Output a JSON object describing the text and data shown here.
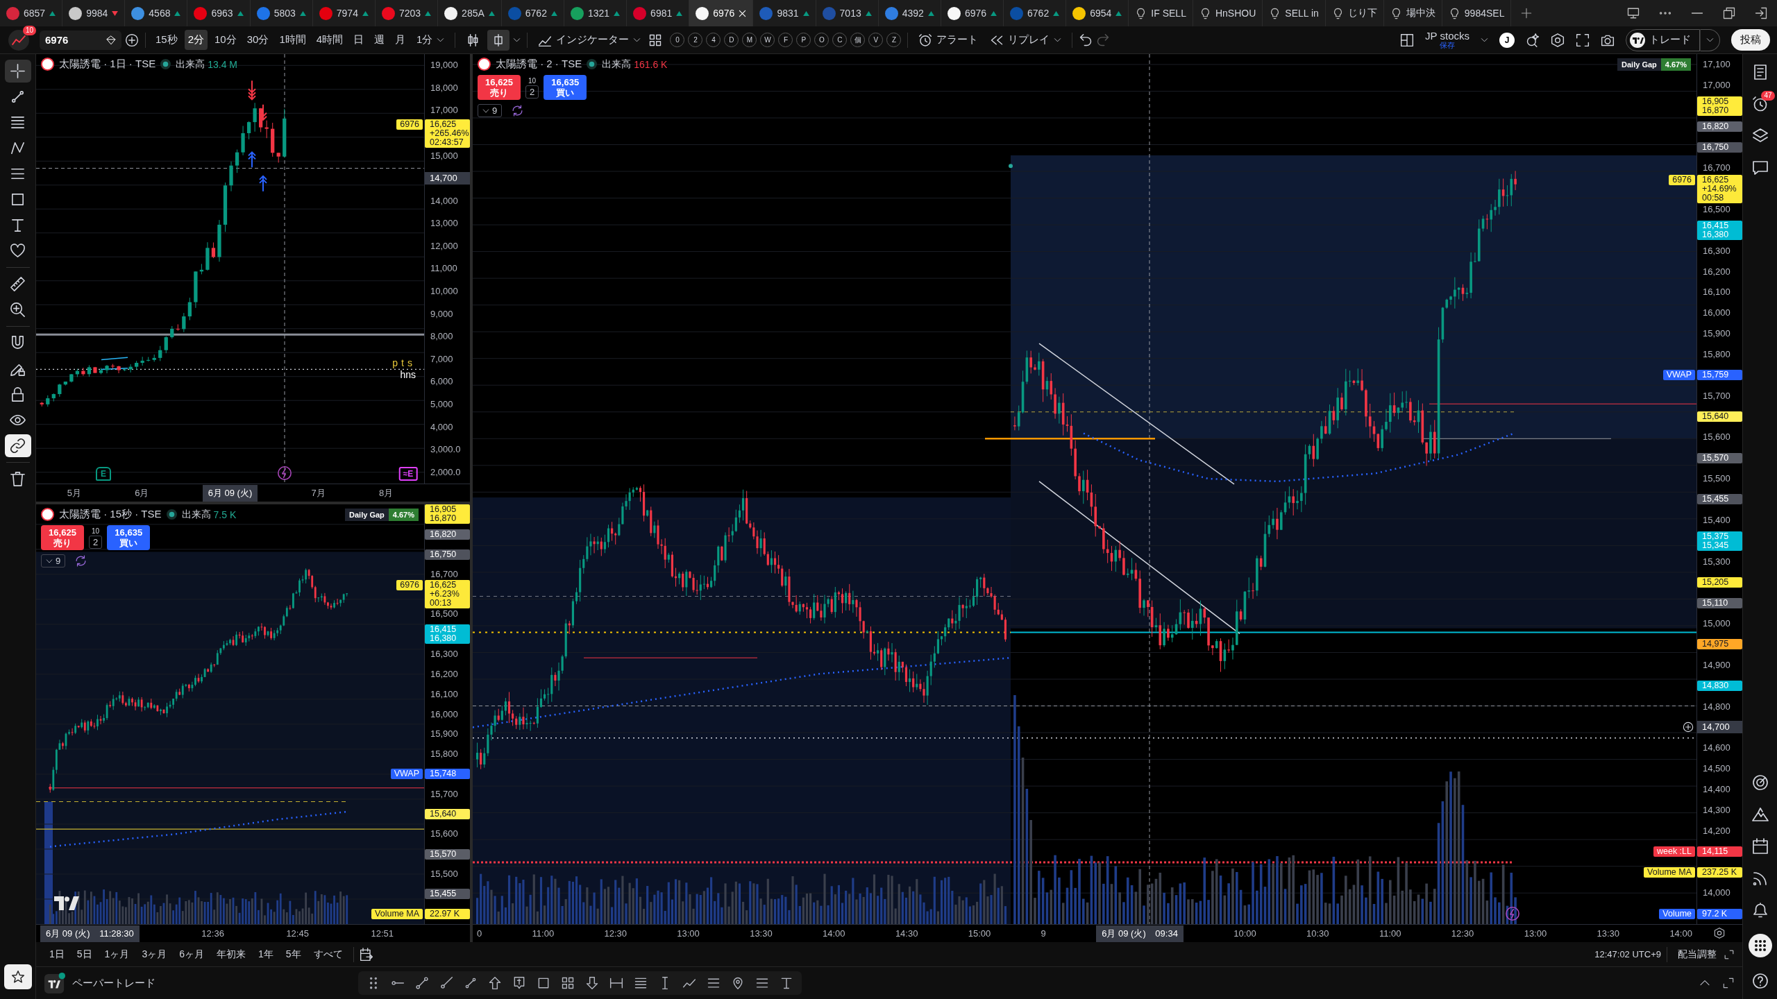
{
  "tab_bar": {
    "tabs": [
      {
        "kind": "symbol",
        "label": "6857",
        "color": "#d7263d",
        "declining": false,
        "selected": false
      },
      {
        "kind": "symbol",
        "label": "9984",
        "color": "#c8c8c8",
        "declining": true,
        "selected": false
      },
      {
        "kind": "symbol",
        "label": "4568",
        "color": "#3d8fe0",
        "declining": false,
        "selected": false
      },
      {
        "kind": "symbol",
        "label": "6963",
        "color": "#e60012",
        "declining": false,
        "selected": false
      },
      {
        "kind": "symbol",
        "label": "5803",
        "color": "#1e73e8",
        "declining": false,
        "selected": false
      },
      {
        "kind": "symbol",
        "label": "7974",
        "color": "#e4000f",
        "declining": false,
        "selected": false
      },
      {
        "kind": "symbol",
        "label": "7203",
        "color": "#eb0a1e",
        "declining": false,
        "selected": false
      },
      {
        "kind": "symbol",
        "label": "285A",
        "color": "#f2f2f2",
        "declining": false,
        "selected": false
      },
      {
        "kind": "symbol",
        "label": "6762",
        "color": "#0b4ea2",
        "declining": false,
        "selected": false
      },
      {
        "kind": "symbol",
        "label": "1321",
        "color": "#17a05d",
        "declining": false,
        "selected": false
      },
      {
        "kind": "symbol",
        "label": "6981",
        "color": "#d6002a",
        "declining": false,
        "selected": false
      },
      {
        "kind": "symbol",
        "label": "6976",
        "color": "#f7f7f7",
        "selected": true
      },
      {
        "kind": "symbol",
        "label": "9831",
        "color": "#1e5bb8",
        "declining": false,
        "selected": false
      },
      {
        "kind": "symbol",
        "label": "7013",
        "color": "#1f4ea1",
        "declining": false,
        "selected": false
      },
      {
        "kind": "symbol",
        "label": "4392",
        "color": "#2f7de1",
        "declining": false,
        "selected": false
      },
      {
        "kind": "symbol",
        "label": "6976",
        "color": "#f7f7f7",
        "declining": false,
        "selected": false
      },
      {
        "kind": "symbol",
        "label": "6762",
        "color": "#0b4ea2",
        "declining": false,
        "selected": false
      },
      {
        "kind": "symbol",
        "label": "6954",
        "color": "#f5c400",
        "declining": false,
        "selected": false
      },
      {
        "kind": "layout",
        "label": "IF SELL",
        "selected": false
      },
      {
        "kind": "layout",
        "label": "HnSHOU",
        "selected": false
      },
      {
        "kind": "layout",
        "label": "SELL in",
        "selected": false
      },
      {
        "kind": "layout",
        "label": "じり下",
        "selected": false
      },
      {
        "kind": "layout",
        "label": "場中決",
        "selected": false
      },
      {
        "kind": "layout",
        "label": "9984SEL",
        "selected": false
      }
    ]
  },
  "toolbar": {
    "alert_count": "10",
    "symbol": "6976",
    "intervals": [
      {
        "label": "15秒",
        "selected": false
      },
      {
        "label": "2分",
        "selected": true
      },
      {
        "label": "10分",
        "selected": false
      },
      {
        "label": "30分",
        "selected": false
      },
      {
        "label": "1時間",
        "selected": false
      },
      {
        "label": "4時間",
        "selected": false
      },
      {
        "label": "日",
        "selected": false
      },
      {
        "label": "週",
        "selected": false
      },
      {
        "label": "月",
        "selected": false
      }
    ],
    "interval_menu": "1分",
    "chart_styles": [
      {
        "kind": "candles",
        "selected": false
      },
      {
        "kind": "hollow",
        "selected": true
      }
    ],
    "indicators": "インジケーター",
    "quick_buttons": [
      "0",
      "2",
      "4",
      "D",
      "M",
      "W",
      "F",
      "P",
      "O",
      "C",
      "個",
      "V",
      "Z"
    ],
    "alert": "アラート",
    "replay": "リプレイ",
    "redo_disabled": true,
    "layout_name": "JP stocks",
    "layout_status": "保存",
    "user_initial": "J",
    "trade": "トレード",
    "publish": "投稿"
  },
  "left_tools": [
    {
      "tools": [
        {
          "kind": "crosshair",
          "selected": true
        },
        {
          "kind": "trend-line",
          "selected": false
        },
        {
          "kind": "fib",
          "selected": false
        },
        {
          "kind": "pattern",
          "selected": false
        },
        {
          "kind": "prediction",
          "selected": false
        },
        {
          "kind": "shapes",
          "selected": false
        },
        {
          "kind": "text",
          "selected": false
        },
        {
          "kind": "favorites",
          "selected": false
        }
      ]
    },
    {
      "tools": [
        {
          "kind": "ruler",
          "selected": false
        },
        {
          "kind": "zoom",
          "selected": false
        }
      ]
    },
    {
      "tools": [
        {
          "kind": "magnet",
          "selected": false
        },
        {
          "kind": "drawing-lock",
          "selected": false
        },
        {
          "kind": "lock",
          "selected": false
        },
        {
          "kind": "hide",
          "selected": false
        },
        {
          "kind": "link",
          "selected": true
        }
      ]
    },
    {
      "tools": [
        {
          "kind": "trash",
          "selected": false
        }
      ]
    }
  ],
  "charts": [
    {
      "kind": "daily",
      "title": "太陽誘電 · 1日 · TSE",
      "volume_label": "出来高",
      "volume_value": "13.4 M",
      "volume_down": false,
      "price_axis": [
        {
          "kind": "tick",
          "label": "19,000"
        },
        {
          "kind": "tick",
          "label": "18,000"
        },
        {
          "kind": "tick",
          "label": "17,000"
        },
        {
          "kind": "tag",
          "color": "#ffeb3b",
          "name": "6976",
          "lines": [
            "16,625",
            "+265.46%",
            "02:43:57"
          ]
        },
        {
          "kind": "tick",
          "label": "15,000"
        },
        {
          "kind": "crosshair",
          "label": "14,700"
        },
        {
          "kind": "tick",
          "label": "14,000"
        },
        {
          "kind": "tick",
          "label": "13,000"
        },
        {
          "kind": "tick",
          "label": "12,000"
        },
        {
          "kind": "tick",
          "label": "11,000"
        },
        {
          "kind": "tick",
          "label": "10,000"
        },
        {
          "kind": "tick",
          "label": "9,000"
        },
        {
          "kind": "tick",
          "label": "8,000"
        },
        {
          "kind": "tick",
          "label": "7,000"
        },
        {
          "kind": "tick",
          "label": "6,000"
        },
        {
          "kind": "tick",
          "label": "5,000"
        },
        {
          "kind": "tick",
          "label": "4,000"
        },
        {
          "kind": "tick",
          "label": "3,000.0"
        },
        {
          "kind": "tick",
          "label": "2,000.0"
        }
      ],
      "time_axis": [
        {
          "kind": "tick",
          "label": "5月"
        },
        {
          "kind": "tick",
          "label": "6月"
        },
        {
          "kind": "crosshair",
          "label": "6月 09 (火)"
        },
        {
          "kind": "tick",
          "label": "7月"
        },
        {
          "kind": "tick",
          "label": "8月"
        }
      ],
      "line_labels": [
        {
          "text": "pts",
          "color": "#e8c93a"
        },
        {
          "text": "hns",
          "color": "#ffffff"
        }
      ],
      "events": [
        {
          "kind": "earnings",
          "label": "E"
        },
        {
          "kind": "news"
        },
        {
          "kind": "earnings-upcoming",
          "label": "≈E"
        }
      ]
    },
    {
      "kind": "fifteen-second",
      "title": "太陽誘電 · 15秒 · TSE",
      "volume_label": "出来高",
      "volume_value": "7.5 K",
      "volume_down": false,
      "order_panel": {
        "sell_price": "16,625",
        "sell_label": "売り",
        "spread": "10",
        "quantity": "2",
        "buy_price": "16,635",
        "buy_label": "買い"
      },
      "collapse_count": "9",
      "daily_gap": {
        "label": "Daily Gap",
        "value": "4.67%"
      },
      "price_axis": [
        {
          "kind": "tag",
          "color": "#ffeb3b",
          "lines": [
            "16,905",
            "16,870"
          ]
        },
        {
          "kind": "tag",
          "color": "#5d606b",
          "lines": [
            "16,820"
          ]
        },
        {
          "kind": "tag",
          "color": "#4f525c",
          "lines": [
            "16,750"
          ]
        },
        {
          "kind": "tick",
          "label": "16,700"
        },
        {
          "kind": "tag",
          "color": "#fde93a",
          "name": "6976",
          "lines": [
            "16,625",
            "+6.23%",
            "00:13"
          ]
        },
        {
          "kind": "tick",
          "label": "16,500"
        },
        {
          "kind": "tag",
          "color": "#00bcd4",
          "lines": [
            "16,415",
            "16,380"
          ]
        },
        {
          "kind": "tick",
          "label": "16,300"
        },
        {
          "kind": "tick",
          "label": "16,200"
        },
        {
          "kind": "tick",
          "label": "16,100"
        },
        {
          "kind": "tick",
          "label": "16,000"
        },
        {
          "kind": "tick",
          "label": "15,900"
        },
        {
          "kind": "tick",
          "label": "15,800"
        },
        {
          "kind": "tag",
          "color": "#2962ff",
          "name": "VWAP",
          "lines": [
            "15,748"
          ]
        },
        {
          "kind": "tick",
          "label": "15,700"
        },
        {
          "kind": "tag",
          "color": "#ffee58",
          "lines": [
            "15,640"
          ]
        },
        {
          "kind": "tick",
          "label": "15,600"
        },
        {
          "kind": "tag",
          "color": "#5a5d66",
          "lines": [
            "15,570"
          ]
        },
        {
          "kind": "tick",
          "label": "15,500"
        },
        {
          "kind": "tag",
          "color": "#50535d",
          "lines": [
            "15,455"
          ]
        },
        {
          "kind": "tag",
          "color": "#ffeb3c",
          "name": "Volume MA",
          "lines": [
            "22.97 K"
          ]
        }
      ],
      "time_axis": [
        {
          "kind": "crosshair",
          "label": "6月 09 (火)",
          "time": "11:28:30"
        },
        {
          "kind": "tick",
          "label": "12:36"
        },
        {
          "kind": "tick",
          "label": "12:45"
        },
        {
          "kind": "tick",
          "label": "12:51"
        }
      ]
    },
    {
      "kind": "two-minute",
      "title": "太陽誘電 · 2 · TSE",
      "volume_label": "出来高",
      "volume_value": "161.6 K",
      "volume_down": true,
      "order_panel": {
        "sell_price": "16,625",
        "sell_label": "売り",
        "spread": "10",
        "quantity": "2",
        "buy_price": "16,635",
        "buy_label": "買い"
      },
      "collapse_count": "9",
      "daily_gap": {
        "label": "Daily Gap",
        "value": "4.67%"
      },
      "price_axis": [
        {
          "kind": "tick",
          "label": "17,100"
        },
        {
          "kind": "tick",
          "label": "17,000"
        },
        {
          "kind": "tag",
          "color": "#ffeb3b",
          "lines": [
            "16,905",
            "16,870"
          ]
        },
        {
          "kind": "tag",
          "color": "#5d606b",
          "lines": [
            "16,820"
          ]
        },
        {
          "kind": "tag",
          "color": "#4f525c",
          "lines": [
            "16,750"
          ]
        },
        {
          "kind": "tick",
          "label": "16,700"
        },
        {
          "kind": "tag",
          "color": "#fde93a",
          "name": "6976",
          "lines": [
            "16,625",
            "+14.69%",
            "00:58"
          ]
        },
        {
          "kind": "tick",
          "label": "16,500"
        },
        {
          "kind": "tag",
          "color": "#00bcd4",
          "lines": [
            "16,415",
            "16,380"
          ]
        },
        {
          "kind": "tick",
          "label": "16,300"
        },
        {
          "kind": "tick",
          "label": "16,200"
        },
        {
          "kind": "tick",
          "label": "16,100"
        },
        {
          "kind": "tick",
          "label": "16,000"
        },
        {
          "kind": "tick",
          "label": "15,900"
        },
        {
          "kind": "tick",
          "label": "15,800"
        },
        {
          "kind": "tag",
          "color": "#2962ff",
          "name": "VWAP",
          "lines": [
            "15,759"
          ]
        },
        {
          "kind": "tick",
          "label": "15,700"
        },
        {
          "kind": "tag",
          "color": "#ffee58",
          "lines": [
            "15,640"
          ]
        },
        {
          "kind": "tick",
          "label": "15,600"
        },
        {
          "kind": "tag",
          "color": "#5a5d66",
          "lines": [
            "15,570"
          ]
        },
        {
          "kind": "tick",
          "label": "15,500"
        },
        {
          "kind": "tag",
          "color": "#50535d",
          "lines": [
            "15,455"
          ]
        },
        {
          "kind": "tick",
          "label": "15,400"
        },
        {
          "kind": "tag",
          "color": "#00bcd5",
          "lines": [
            "15,375",
            "15,345"
          ]
        },
        {
          "kind": "tick",
          "label": "15,300"
        },
        {
          "kind": "tag",
          "color": "#ffea3a",
          "lines": [
            "15,205"
          ]
        },
        {
          "kind": "tag",
          "color": "#585b64",
          "lines": [
            "15,110"
          ]
        },
        {
          "kind": "tick",
          "label": "15,000"
        },
        {
          "kind": "tag",
          "color": "#ffa726",
          "lines": [
            "14,975"
          ]
        },
        {
          "kind": "tick",
          "label": "14,900"
        },
        {
          "kind": "tag",
          "color": "#00bcd6",
          "lines": [
            "14,830"
          ]
        },
        {
          "kind": "tick",
          "label": "14,800"
        },
        {
          "kind": "crosshair",
          "label": "14,700",
          "add_button": true
        },
        {
          "kind": "tick",
          "label": "14,600"
        },
        {
          "kind": "tick",
          "label": "14,500"
        },
        {
          "kind": "tick",
          "label": "14,400"
        },
        {
          "kind": "tick",
          "label": "14,300"
        },
        {
          "kind": "tick",
          "label": "14,200"
        },
        {
          "kind": "tag",
          "color": "#f23645",
          "name": "week :LL",
          "lines": [
            "14,115"
          ]
        },
        {
          "kind": "tag",
          "color": "#ffeb3c",
          "name": "Volume MA",
          "lines": [
            "237.25 K"
          ]
        },
        {
          "kind": "tick",
          "label": "14,000"
        },
        {
          "kind": "tag",
          "color": "#2962fe",
          "name": "Volume",
          "lines": [
            "97.2 K"
          ]
        }
      ],
      "time_axis": [
        {
          "kind": "tick",
          "label": "0"
        },
        {
          "kind": "tick",
          "label": "11:00"
        },
        {
          "kind": "tick",
          "label": "12:30"
        },
        {
          "kind": "tick",
          "label": "13:00"
        },
        {
          "kind": "tick",
          "label": "13:30"
        },
        {
          "kind": "tick",
          "label": "14:00"
        },
        {
          "kind": "tick",
          "label": "14:30"
        },
        {
          "kind": "tick",
          "label": "15:00"
        },
        {
          "kind": "tick",
          "label": "9"
        },
        {
          "kind": "crosshair",
          "label": "6月 09 (火)",
          "time": "09:34"
        },
        {
          "kind": "tick",
          "label": "10:00"
        },
        {
          "kind": "tick",
          "label": "10:30"
        },
        {
          "kind": "tick",
          "label": "11:00"
        },
        {
          "kind": "tick",
          "label": "12:30"
        },
        {
          "kind": "tick",
          "label": "13:00"
        },
        {
          "kind": "tick",
          "label": "13:30"
        },
        {
          "kind": "tick",
          "label": "14:00"
        }
      ],
      "events": [
        {
          "kind": "news"
        }
      ]
    }
  ],
  "bottom_bar": {
    "ranges": [
      "1日",
      "5日",
      "1ヶ月",
      "3ヶ月",
      "6ヶ月",
      "年初来",
      "1年",
      "5年",
      "すべて"
    ],
    "clock": "12:47:02 UTC+9",
    "adjustment": "配当調整"
  },
  "trading_panel": {
    "label": "ペーパートレード"
  },
  "right_sidebar": {
    "alert_badge": "47"
  }
}
